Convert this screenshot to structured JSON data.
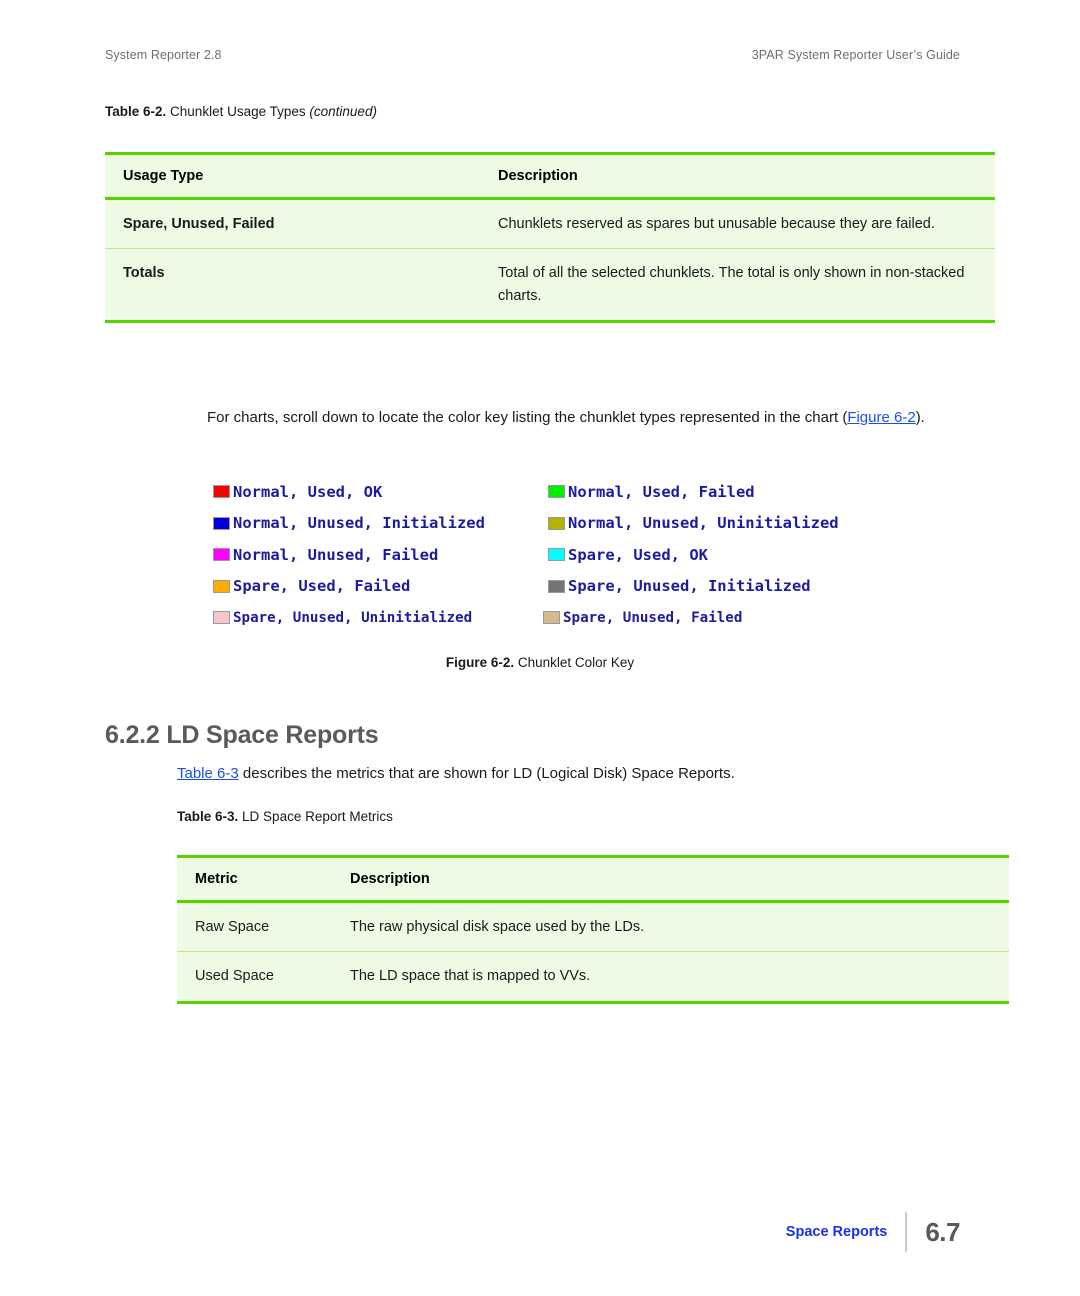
{
  "header": {
    "left": "System Reporter 2.8",
    "right": "3PAR System Reporter User’s Guide"
  },
  "table_6_2": {
    "caption_number": "Table 6-2.",
    "caption_text": "Chunklet Usage Types",
    "caption_italic": "(continued)",
    "columns": [
      "Usage Type",
      "Description"
    ],
    "rows": [
      {
        "usage_type": "Spare, Unused, Failed",
        "description": "Chunklets reserved as spares but unusable because they are failed."
      },
      {
        "usage_type": "Totals",
        "description": "Total of all the selected chunklets. The total is only shown in non-stacked charts."
      }
    ]
  },
  "paragraph_color_key": {
    "before": "For charts, scroll down to locate the color key listing the chunklet types represented in the chart (",
    "xref": "Figure 6-2",
    "after": ")."
  },
  "figure_6_2": {
    "caption_number": "Figure 6-2.",
    "caption_text": "Chunklet Color Key",
    "legend": [
      {
        "label": "Normal, Used, OK",
        "color": "#ff0000"
      },
      {
        "label": "Normal, Used, Failed",
        "color": "#00ee00"
      },
      {
        "label": "Normal, Unused, Initialized",
        "color": "#0000dd"
      },
      {
        "label": "Normal, Unused, Uninitialized",
        "color": "#b3b300"
      },
      {
        "label": "Normal, Unused, Failed",
        "color": "#ff00ff"
      },
      {
        "label": "Spare, Used, OK",
        "color": "#00ffff"
      },
      {
        "label": "Spare, Used, Failed",
        "color": "#ffab00"
      },
      {
        "label": "Spare, Unused, Initialized",
        "color": "#757575"
      },
      {
        "label": "Spare, Unused, Uninitialized",
        "color": "#f6c6cd"
      },
      {
        "label": "Spare, Unused, Failed",
        "color": "#d6b98e"
      }
    ]
  },
  "section": {
    "number": "6.2.2",
    "title": "LD Space Reports"
  },
  "paragraph_table_6_3": {
    "xref": "Table 6-3",
    "after": " describes the metrics that are shown for LD (Logical Disk) Space Reports."
  },
  "table_6_3": {
    "caption_number": "Table 6-3.",
    "caption_text": "LD Space Report Metrics",
    "columns": [
      "Metric",
      "Description"
    ],
    "rows": [
      {
        "metric": "Raw Space",
        "description": "The raw physical disk space used by the LDs."
      },
      {
        "metric": "Used Space",
        "description": "The LD space that is mapped to VVs."
      }
    ]
  },
  "footer": {
    "section_label": "Space Reports",
    "page_number": "6.7"
  },
  "colors": {
    "table_background": "#eefae4",
    "table_rule": "#57d400",
    "table_rule_light": "#b5e98a",
    "xref_link": "#1b4ee8",
    "heading_gray": "#5a5a5a",
    "legend_text": "#1c1c9c",
    "footer_link": "#1b31e8"
  }
}
